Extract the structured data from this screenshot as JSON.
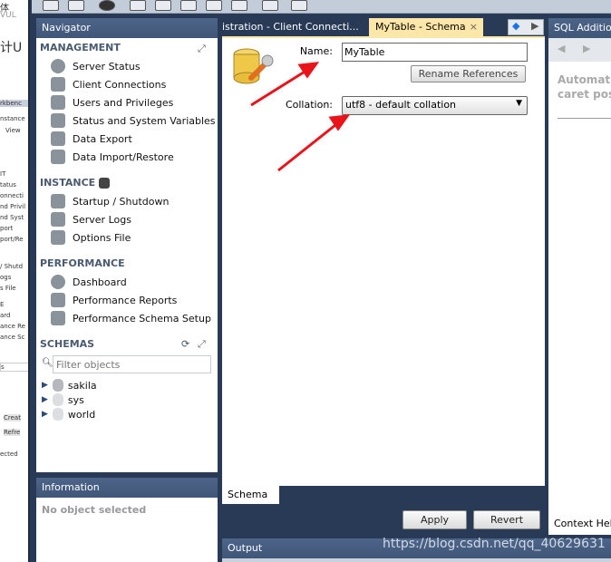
{
  "navigator": {
    "title": "Navigator",
    "management": {
      "title": "MANAGEMENT",
      "items": [
        {
          "label": "Server Status",
          "icon": "play-circle-icon"
        },
        {
          "label": "Client Connections",
          "icon": "database-network-icon"
        },
        {
          "label": "Users and Privileges",
          "icon": "user-icon"
        },
        {
          "label": "Status and System Variables",
          "icon": "monitor-icon"
        },
        {
          "label": "Data Export",
          "icon": "upload-icon"
        },
        {
          "label": "Data Import/Restore",
          "icon": "download-icon"
        }
      ]
    },
    "instance": {
      "title": "INSTANCE",
      "items": [
        {
          "label": "Startup / Shutdown",
          "icon": "play-icon"
        },
        {
          "label": "Server Logs",
          "icon": "warning-icon"
        },
        {
          "label": "Options File",
          "icon": "wrench-icon"
        }
      ]
    },
    "performance": {
      "title": "PERFORMANCE",
      "items": [
        {
          "label": "Dashboard",
          "icon": "gauge-icon"
        },
        {
          "label": "Performance Reports",
          "icon": "report-icon"
        },
        {
          "label": "Performance Schema Setup",
          "icon": "gear-icon"
        }
      ]
    },
    "schemas": {
      "title": "SCHEMAS",
      "filter_placeholder": "Filter objects",
      "items": [
        "sakila",
        "sys",
        "world"
      ]
    }
  },
  "information": {
    "title": "Information",
    "text": "No object selected"
  },
  "tabs": [
    {
      "label": "istration - Client Connecti..."
    },
    {
      "label": "MyTable - Schema",
      "active": true
    }
  ],
  "editor": {
    "name_label": "Name:",
    "name_value": "MyTable",
    "rename_button": "Rename References",
    "collation_label": "Collation:",
    "collation_value": "utf8 - default collation",
    "bottom_tab": "Schema"
  },
  "actions": {
    "apply": "Apply",
    "revert": "Revert"
  },
  "output": {
    "title": "Output"
  },
  "right_panel": {
    "title": "SQL Additions",
    "text_line1": "Automati",
    "text_line2": "caret pos",
    "context_help": "Context Help"
  },
  "left_window": {
    "lines": [
      "体",
      "VUL",
      "计U",
      "rkbenc",
      "nstance",
      "View",
      "IT",
      "tatus",
      "onnecti",
      "nd Privil",
      "nd Syst",
      "port",
      "port/Re",
      "/ Shutd",
      "ogs",
      "s File",
      "E",
      "ard",
      "ance Re",
      "ance Sc",
      "s",
      "Creat",
      "Refre",
      "ected"
    ]
  },
  "watermark": "https://blog.csdn.net/qq_40629631",
  "colors": {
    "background": "#283a56",
    "panel_header": "#445c80",
    "active_tab": "#fde7a8",
    "annotation_arrow": "#e8141a"
  }
}
